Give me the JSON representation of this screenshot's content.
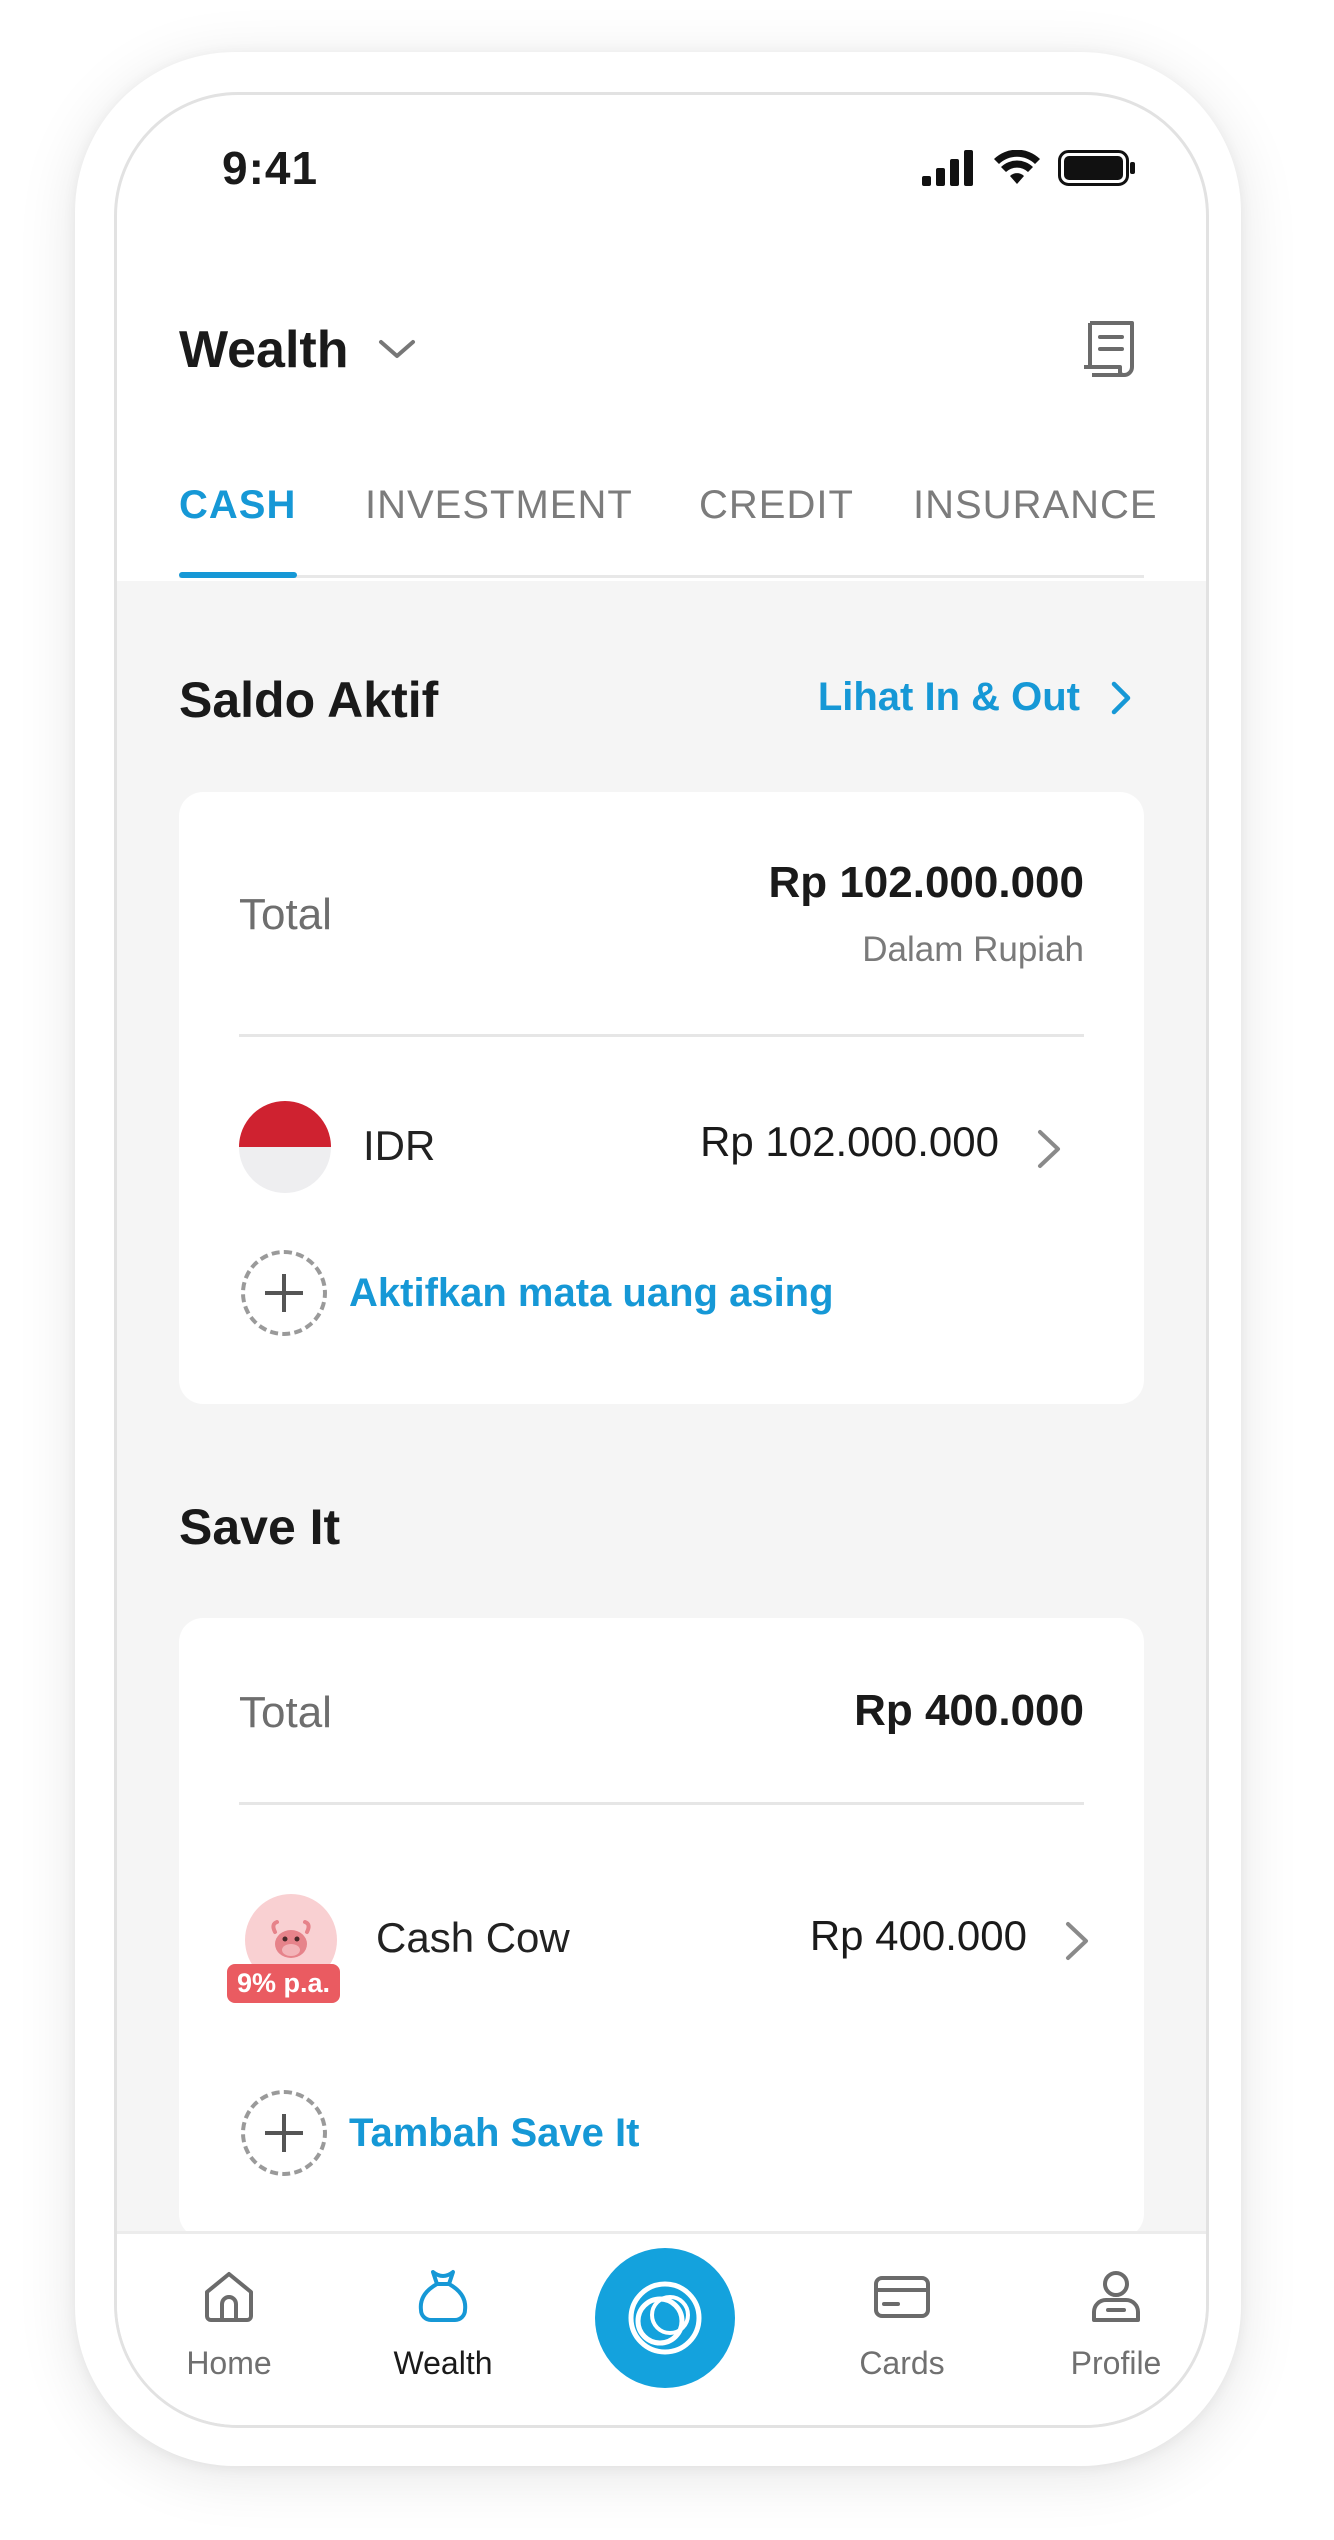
{
  "status_bar": {
    "time": "9:41"
  },
  "header": {
    "title": "Wealth"
  },
  "tabs": [
    {
      "label": "CASH",
      "active": true
    },
    {
      "label": "INVESTMENT",
      "active": false
    },
    {
      "label": "CREDIT",
      "active": false
    },
    {
      "label": "INSURANCE",
      "active": false
    }
  ],
  "saldo_aktif": {
    "title": "Saldo Aktif",
    "link_label": "Lihat In & Out",
    "total_label": "Total",
    "total_amount": "Rp 102.000.000",
    "total_sub": "Dalam Rupiah",
    "accounts": [
      {
        "currency": "IDR",
        "amount": "Rp 102.000.000"
      }
    ],
    "add_label": "Aktifkan mata uang asing"
  },
  "save_it": {
    "title": "Save It",
    "total_label": "Total",
    "total_amount": "Rp 400.000",
    "items": [
      {
        "name": "Cash Cow",
        "amount": "Rp 400.000",
        "badge": "9% p.a."
      }
    ],
    "add_label": "Tambah Save It"
  },
  "bottom_nav": {
    "items": [
      {
        "label": "Home",
        "icon": "home-icon",
        "active": false
      },
      {
        "label": "Wealth",
        "icon": "money-bag-icon",
        "active": true
      },
      {
        "label": "Cards",
        "icon": "card-icon",
        "active": false
      },
      {
        "label": "Profile",
        "icon": "profile-icon",
        "active": false
      }
    ],
    "center_icon": "rings-logo-icon"
  },
  "colors": {
    "accent": "#1698d6",
    "badge": "#ea5b61",
    "flag_red": "#cf2230",
    "background": "#f5f5f5"
  }
}
